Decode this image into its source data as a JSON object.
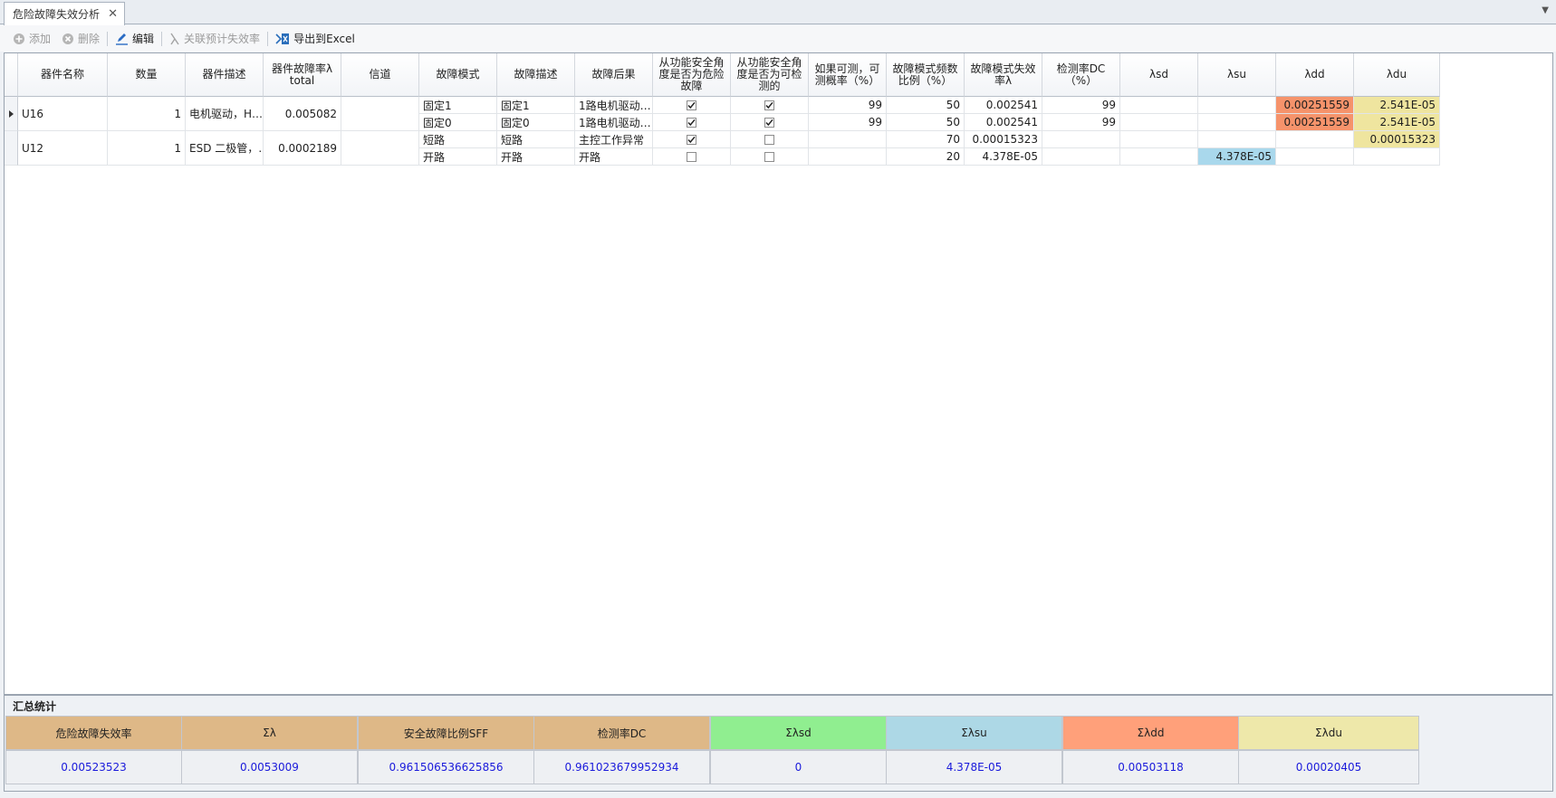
{
  "tab": {
    "title": "危险故障失效分析",
    "close": "✕",
    "menu": "▼"
  },
  "toolbar": {
    "add": "添加",
    "delete": "删除",
    "edit": "编辑",
    "link": "关联预计失效率",
    "export": "导出到Excel"
  },
  "grid": {
    "headers": [
      "器件名称",
      "数量",
      "器件描述",
      "器件故障率λ total",
      "信道",
      "故障模式",
      "故障描述",
      "故障后果",
      "从功能安全角度是否为危险故障",
      "从功能安全角度是否为可检测的",
      "如果可测，可测概率（%）",
      "故障模式频数比例（%）",
      "故障模式失效率λ",
      "检测率DC（%）",
      "λsd",
      "λsu",
      "λdd",
      "λdu"
    ],
    "components": [
      {
        "name": "U16",
        "qty": "1",
        "desc": "电机驱动，H…",
        "rate": "0.005082",
        "channel": ""
      },
      {
        "name": "U12",
        "qty": "1",
        "desc": "ESD 二极管，…",
        "rate": "0.0002189",
        "channel": ""
      }
    ],
    "modes": [
      {
        "mode": "固定1",
        "desc": "固定1",
        "effect": "1路电机驱动…",
        "dangerous": true,
        "detectable": true,
        "prob": "99",
        "ratio": "50",
        "lambda": "0.002541",
        "dc": "99",
        "sd": "",
        "su": "",
        "dd": "0.00251559",
        "du": "2.541E-05"
      },
      {
        "mode": "固定0",
        "desc": "固定0",
        "effect": "1路电机驱动…",
        "dangerous": true,
        "detectable": true,
        "prob": "99",
        "ratio": "50",
        "lambda": "0.002541",
        "dc": "99",
        "sd": "",
        "su": "",
        "dd": "0.00251559",
        "du": "2.541E-05"
      },
      {
        "mode": "短路",
        "desc": "短路",
        "effect": "主控工作异常",
        "dangerous": true,
        "detectable": false,
        "prob": "",
        "ratio": "70",
        "lambda": "0.00015323",
        "dc": "",
        "sd": "",
        "su": "",
        "dd": "",
        "du": "0.00015323"
      },
      {
        "mode": "开路",
        "desc": "开路",
        "effect": "开路",
        "dangerous": false,
        "detectable": false,
        "prob": "",
        "ratio": "20",
        "lambda": "4.378E-05",
        "dc": "",
        "sd": "",
        "su": "4.378E-05",
        "dd": "",
        "du": ""
      }
    ]
  },
  "summary": {
    "title": "汇总统计",
    "headers": [
      "危险故障失效率",
      "Σλ",
      "安全故障比例SFF",
      "检测率DC",
      "Σλsd",
      "Σλsu",
      "Σλdd",
      "Σλdu"
    ],
    "values": [
      "0.00523523",
      "0.0053009",
      "0.961506536625856",
      "0.961023679952934",
      "0",
      "4.378E-05",
      "0.00503118",
      "0.00020405"
    ],
    "header_colors": [
      "#deb887",
      "#deb887",
      "#deb887",
      "#deb887",
      "#90ee90",
      "#add8e6",
      "#ffa07a",
      "#eee8aa"
    ]
  },
  "colors": {
    "dd": "#f6936b",
    "du": "#efe59f",
    "su": "#a9d8ec"
  }
}
